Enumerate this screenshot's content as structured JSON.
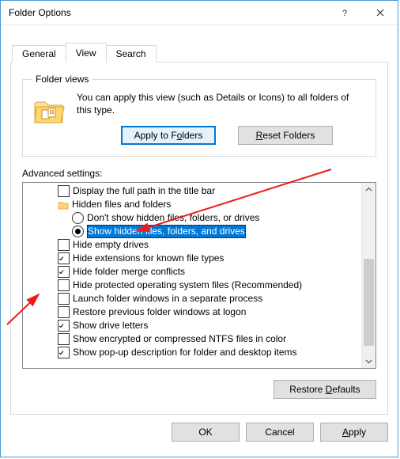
{
  "window": {
    "title": "Folder Options"
  },
  "tabs": {
    "general": "General",
    "view": "View",
    "search": "Search",
    "active": "view"
  },
  "folder_views": {
    "legend": "Folder views",
    "text": "You can apply this view (such as Details or Icons) to all folders of this type.",
    "apply_btn": "Apply to Folders",
    "reset_btn": "Reset Folders"
  },
  "advanced": {
    "label": "Advanced settings:",
    "restore_btn": "Restore Defaults",
    "items": [
      {
        "kind": "check",
        "checked": false,
        "label": "Display the full path in the title bar"
      },
      {
        "kind": "group",
        "label": "Hidden files and folders"
      },
      {
        "kind": "radio",
        "selected": false,
        "label": "Don't show hidden files, folders, or drives"
      },
      {
        "kind": "radio",
        "selected": true,
        "highlight": true,
        "label": "Show hidden files, folders, and drives"
      },
      {
        "kind": "check",
        "checked": false,
        "label": "Hide empty drives"
      },
      {
        "kind": "check",
        "checked": true,
        "label": "Hide extensions for known file types"
      },
      {
        "kind": "check",
        "checked": true,
        "label": "Hide folder merge conflicts"
      },
      {
        "kind": "check",
        "checked": false,
        "label": "Hide protected operating system files (Recommended)"
      },
      {
        "kind": "check",
        "checked": false,
        "label": "Launch folder windows in a separate process"
      },
      {
        "kind": "check",
        "checked": false,
        "label": "Restore previous folder windows at logon"
      },
      {
        "kind": "check",
        "checked": true,
        "label": "Show drive letters"
      },
      {
        "kind": "check",
        "checked": false,
        "label": "Show encrypted or compressed NTFS files in color"
      },
      {
        "kind": "check",
        "checked": true,
        "label": "Show pop-up description for folder and desktop items"
      }
    ]
  },
  "buttons": {
    "ok": "OK",
    "cancel": "Cancel",
    "apply": "Apply"
  },
  "colors": {
    "accent": "#0078d7",
    "annotation": "#ef1b1b"
  }
}
